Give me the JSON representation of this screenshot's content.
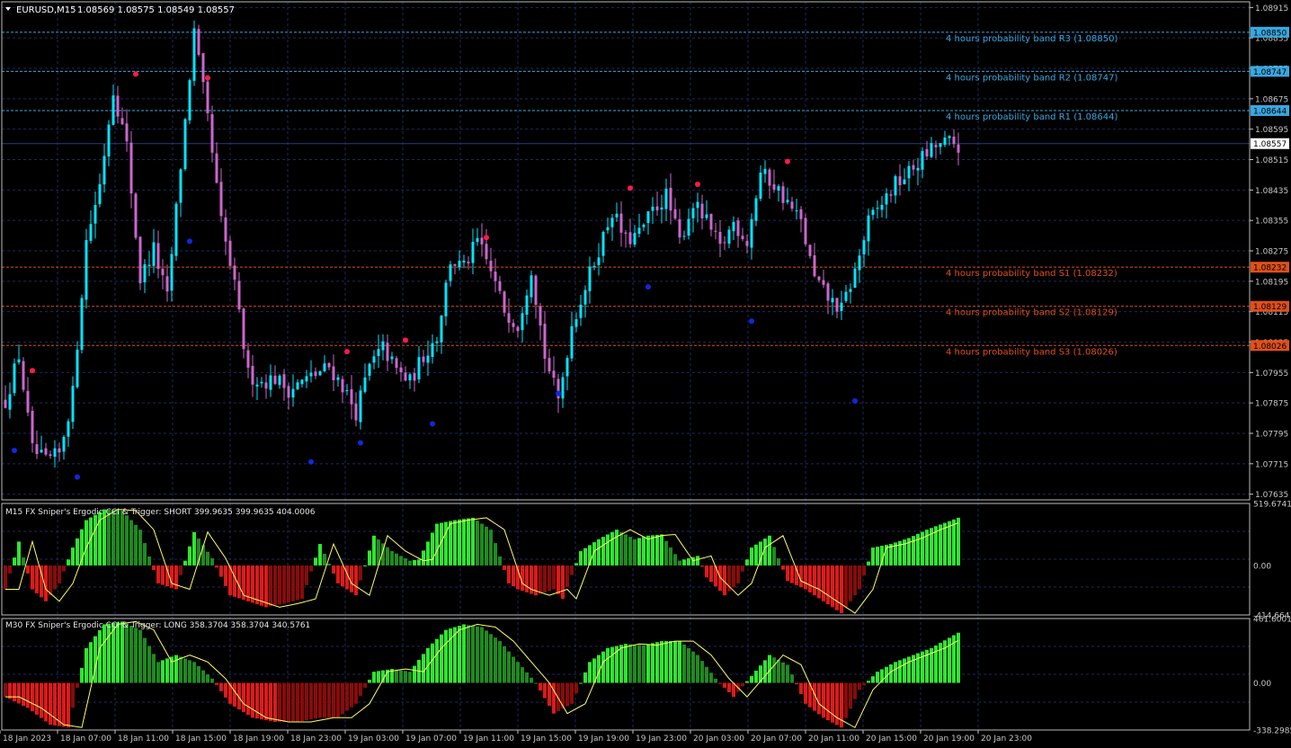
{
  "header": {
    "symbol_label": "EURUSD,M15",
    "ohlc": "1.08569 1.08575 1.08549 1.08557"
  },
  "colors": {
    "background": "#000000",
    "grid": "#1c2a5a",
    "axis": "#c8c8c8",
    "bull_candle": "#00e5ff",
    "bear_candle": "#cc66cc",
    "resistance": "#3aa7e0",
    "support": "#e0501a",
    "up_dot": "#ff1a4a",
    "down_dot": "#1028e0",
    "cci_bright_green": "#2ee62e",
    "cci_dark_green": "#1f8a1f",
    "cci_bright_red": "#e01818",
    "cci_dark_red": "#8a0a0a",
    "cci_line": "#ffff66",
    "price_tag": "#ffffff"
  },
  "chart_data": [
    {
      "type": "candlestick",
      "title": "EURUSD,M15",
      "ylim": [
        1.0762,
        1.0893
      ],
      "y_ticks": [
        "1.08915",
        "1.08835",
        "1.08755",
        "1.08675",
        "1.08595",
        "1.08515",
        "1.08435",
        "1.08355",
        "1.08275",
        "1.08195",
        "1.08115",
        "1.08035",
        "1.07955",
        "1.07875",
        "1.07795",
        "1.07715",
        "1.07635"
      ],
      "x_ticks": [
        "18 Jan 2023",
        "18 Jan 07:00",
        "18 Jan 11:00",
        "18 Jan 15:00",
        "18 Jan 19:00",
        "18 Jan 23:00",
        "19 Jan 03:00",
        "19 Jan 07:00",
        "19 Jan 11:00",
        "19 Jan 15:00",
        "19 Jan 19:00",
        "19 Jan 23:00",
        "20 Jan 03:00",
        "20 Jan 07:00",
        "20 Jan 11:00",
        "20 Jan 15:00",
        "20 Jan 19:00",
        "20 Jan 23:00"
      ],
      "close_path": [
        [
          0,
          1.0788
        ],
        [
          3,
          1.08
        ],
        [
          6,
          1.0775
        ],
        [
          9,
          1.0772
        ],
        [
          12,
          1.0774
        ],
        [
          15,
          1.079
        ],
        [
          18,
          1.083
        ],
        [
          21,
          1.0845
        ],
        [
          24,
          1.087
        ],
        [
          27,
          1.0855
        ],
        [
          30,
          1.082
        ],
        [
          33,
          1.0828
        ],
        [
          36,
          1.0815
        ],
        [
          39,
          1.085
        ],
        [
          42,
          1.0885
        ],
        [
          45,
          1.0862
        ],
        [
          48,
          1.0835
        ],
        [
          51,
          1.0818
        ],
        [
          54,
          1.0795
        ],
        [
          57,
          1.0793
        ],
        [
          60,
          1.0794
        ],
        [
          63,
          1.0791
        ],
        [
          66,
          1.0793
        ],
        [
          69,
          1.0795
        ],
        [
          72,
          1.0797
        ],
        [
          75,
          1.0792
        ],
        [
          78,
          1.0785
        ],
        [
          81,
          1.0797
        ],
        [
          84,
          1.0802
        ],
        [
          87,
          1.0796
        ],
        [
          90,
          1.0793
        ],
        [
          93,
          1.08
        ],
        [
          96,
          1.0805
        ],
        [
          99,
          1.0825
        ],
        [
          102,
          1.0823
        ],
        [
          105,
          1.083
        ],
        [
          108,
          1.0822
        ],
        [
          111,
          1.0812
        ],
        [
          114,
          1.0808
        ],
        [
          117,
          1.0823
        ],
        [
          120,
          1.08
        ],
        [
          123,
          1.0788
        ],
        [
          126,
          1.0808
        ],
        [
          129,
          1.0818
        ],
        [
          132,
          1.0828
        ],
        [
          135,
          1.0838
        ],
        [
          138,
          1.083
        ],
        [
          141,
          1.0832
        ],
        [
          144,
          1.0838
        ],
        [
          147,
          1.0842
        ],
        [
          150,
          1.083
        ],
        [
          153,
          1.084
        ],
        [
          156,
          1.0835
        ],
        [
          159,
          1.0828
        ],
        [
          162,
          1.0835
        ],
        [
          165,
          1.083
        ],
        [
          168,
          1.0848
        ],
        [
          171,
          1.0845
        ],
        [
          174,
          1.084
        ],
        [
          177,
          1.0835
        ],
        [
          180,
          1.082
        ],
        [
          183,
          1.0815
        ],
        [
          186,
          1.0812
        ],
        [
          189,
          1.0822
        ],
        [
          192,
          1.0835
        ],
        [
          195,
          1.084
        ],
        [
          198,
          1.0845
        ],
        [
          201,
          1.0848
        ],
        [
          204,
          1.0852
        ],
        [
          207,
          1.0855
        ],
        [
          210,
          1.0856
        ],
        [
          212,
          1.0855
        ]
      ],
      "levels": [
        {
          "name": "R3",
          "label": "4 hours probability band R3 (1.08850)",
          "value": 1.0885,
          "tag": "1.08850",
          "kind": "resistance"
        },
        {
          "name": "R2",
          "label": "4 hours probability band R2 (1.08747)",
          "value": 1.08747,
          "tag": "1.08747",
          "kind": "resistance"
        },
        {
          "name": "R1",
          "label": "4 hours probability band R1 (1.08644)",
          "value": 1.08644,
          "tag": "1.08644",
          "kind": "resistance"
        },
        {
          "name": "S1",
          "label": "4 hours probability band S1 (1.08232)",
          "value": 1.08232,
          "tag": "1.08232",
          "kind": "support"
        },
        {
          "name": "S2",
          "label": "4 hours probability band S2 (1.08129)",
          "value": 1.08129,
          "tag": "1.08129",
          "kind": "support"
        },
        {
          "name": "S3",
          "label": "4 hours probability band S3 (1.08026)",
          "value": 1.08026,
          "tag": "1.08026",
          "kind": "support"
        }
      ],
      "current_price": {
        "value": 1.08557,
        "tag": "1.08557"
      },
      "up_fractals": [
        [
          6,
          1.0796
        ],
        [
          29,
          1.0874
        ],
        [
          45,
          1.0873
        ],
        [
          76,
          1.0801
        ],
        [
          89,
          1.0804
        ],
        [
          107,
          1.0831
        ],
        [
          139,
          1.0844
        ],
        [
          154,
          1.0845
        ],
        [
          174,
          1.0851
        ]
      ],
      "down_fractals": [
        [
          2,
          1.0775
        ],
        [
          16,
          1.0768
        ],
        [
          41,
          1.083
        ],
        [
          68,
          1.0772
        ],
        [
          79,
          1.0777
        ],
        [
          95,
          1.0782
        ],
        [
          123,
          1.079
        ],
        [
          143,
          1.0818
        ],
        [
          166,
          1.0809
        ],
        [
          189,
          1.0788
        ]
      ]
    },
    {
      "type": "bar",
      "title": "M15 FX Sniper's Ergodic CCI & Trigger: SHORT 399.9635 399.9635 404.0006",
      "ylim": [
        -414.6641,
        519.6741
      ],
      "y_ticks": [
        "519.6741",
        "0.00",
        "-414.6641"
      ],
      "path": [
        [
          0,
          -200
        ],
        [
          3,
          200
        ],
        [
          6,
          -200
        ],
        [
          9,
          -300
        ],
        [
          12,
          -150
        ],
        [
          15,
          150
        ],
        [
          18,
          380
        ],
        [
          22,
          470
        ],
        [
          26,
          460
        ],
        [
          30,
          300
        ],
        [
          34,
          -150
        ],
        [
          38,
          -200
        ],
        [
          42,
          280
        ],
        [
          46,
          60
        ],
        [
          50,
          -250
        ],
        [
          54,
          -300
        ],
        [
          58,
          -350
        ],
        [
          62,
          -320
        ],
        [
          66,
          -280
        ],
        [
          70,
          180
        ],
        [
          74,
          -150
        ],
        [
          78,
          -250
        ],
        [
          82,
          250
        ],
        [
          86,
          120
        ],
        [
          90,
          40
        ],
        [
          92,
          50
        ],
        [
          96,
          350
        ],
        [
          100,
          380
        ],
        [
          104,
          400
        ],
        [
          108,
          300
        ],
        [
          112,
          -150
        ],
        [
          114,
          -200
        ],
        [
          118,
          -250
        ],
        [
          122,
          -200
        ],
        [
          124,
          -280
        ],
        [
          128,
          120
        ],
        [
          132,
          220
        ],
        [
          136,
          300
        ],
        [
          140,
          220
        ],
        [
          143,
          250
        ],
        [
          146,
          260
        ],
        [
          150,
          40
        ],
        [
          154,
          80
        ],
        [
          156,
          -100
        ],
        [
          160,
          -250
        ],
        [
          163,
          -150
        ],
        [
          166,
          150
        ],
        [
          170,
          250
        ],
        [
          174,
          -130
        ],
        [
          178,
          -200
        ],
        [
          182,
          -300
        ],
        [
          186,
          -400
        ],
        [
          190,
          -200
        ],
        [
          193,
          150
        ],
        [
          197,
          180
        ],
        [
          201,
          230
        ],
        [
          205,
          300
        ],
        [
          212,
          400
        ]
      ]
    },
    {
      "type": "bar",
      "title": "M30 FX Sniper's Ergodic CCI & Trigger: LONG 358.3704 358.3704 340.5761",
      "ylim": [
        -338.2985,
        461.6001
      ],
      "y_ticks": [
        "461.6001",
        "0.00",
        "-338.2985"
      ],
      "path": [
        [
          0,
          -100
        ],
        [
          5,
          -180
        ],
        [
          10,
          -300
        ],
        [
          14,
          -320
        ],
        [
          18,
          250
        ],
        [
          22,
          420
        ],
        [
          26,
          440
        ],
        [
          30,
          380
        ],
        [
          34,
          150
        ],
        [
          38,
          200
        ],
        [
          42,
          150
        ],
        [
          46,
          30
        ],
        [
          50,
          -150
        ],
        [
          55,
          -250
        ],
        [
          60,
          -280
        ],
        [
          65,
          -280
        ],
        [
          70,
          -250
        ],
        [
          74,
          -250
        ],
        [
          78,
          -150
        ],
        [
          82,
          80
        ],
        [
          86,
          100
        ],
        [
          90,
          80
        ],
        [
          94,
          250
        ],
        [
          98,
          380
        ],
        [
          102,
          420
        ],
        [
          106,
          400
        ],
        [
          110,
          300
        ],
        [
          114,
          150
        ],
        [
          118,
          0
        ],
        [
          122,
          -220
        ],
        [
          126,
          -150
        ],
        [
          130,
          150
        ],
        [
          134,
          250
        ],
        [
          138,
          280
        ],
        [
          142,
          270
        ],
        [
          146,
          300
        ],
        [
          150,
          300
        ],
        [
          154,
          200
        ],
        [
          158,
          30
        ],
        [
          162,
          -100
        ],
        [
          166,
          50
        ],
        [
          170,
          200
        ],
        [
          174,
          130
        ],
        [
          178,
          -150
        ],
        [
          182,
          -250
        ],
        [
          186,
          -320
        ],
        [
          190,
          -50
        ],
        [
          194,
          80
        ],
        [
          198,
          150
        ],
        [
          202,
          200
        ],
        [
          206,
          250
        ],
        [
          212,
          360
        ]
      ]
    }
  ]
}
